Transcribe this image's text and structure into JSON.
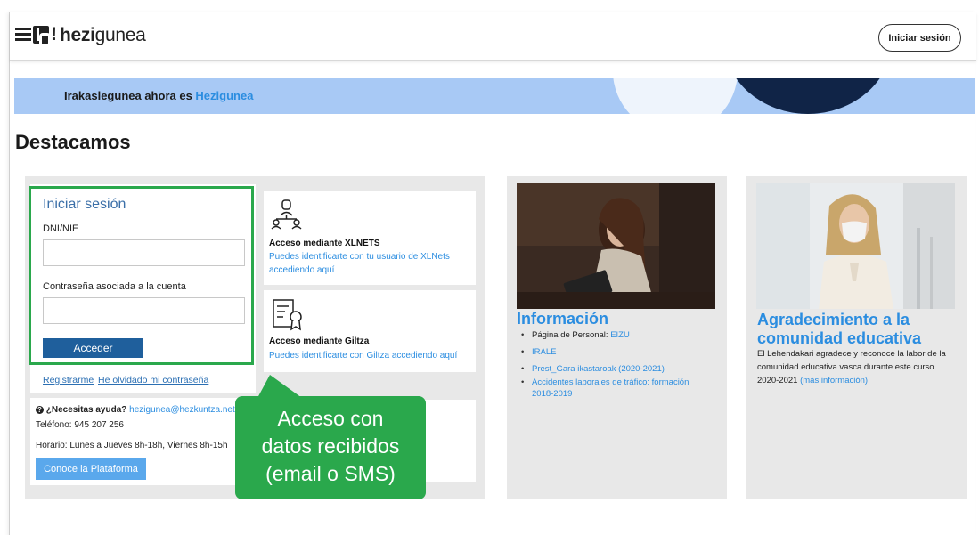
{
  "header": {
    "logo_excl": "!",
    "logo_bold": "hezi",
    "logo_rest": "gunea",
    "login_button": "Iniciar sesión"
  },
  "banner": {
    "text": "Irakaslegunea ahora es ",
    "link": "Hezigunea"
  },
  "section_title": "Destacamos",
  "login": {
    "title": "Iniciar sesión",
    "dni_label": "DNI/NIE",
    "dni_value": "",
    "password_label": "Contraseña asociada a la cuenta",
    "password_value": "",
    "submit": "Acceder",
    "register": "Registrarme",
    "forgot": "He olvidado mi contraseña"
  },
  "help": {
    "question": "¿Necesitas ayuda?",
    "email": "hezigunea@hezkuntza.net",
    "phone": "Teléfono: 945 207 256",
    "hours": "Horario: Lunes a Jueves 8h-18h, Viernes 8h-15h",
    "platform_button": "Conoce la Plataforma"
  },
  "access_options": [
    {
      "title": "Acceso mediante XLNETS",
      "desc_line1": "Puedes identificarte con tu usuario de XLNets",
      "desc_line2": "accediendo aquí",
      "icon": "user-network-icon"
    },
    {
      "title": "Acceso mediante Giltza",
      "desc_line1": "Puedes identificarte con Giltza accediendo aquí",
      "icon": "certificate-icon"
    }
  ],
  "callout": {
    "line1": "Acceso con",
    "line2": "datos recibidos",
    "line3": "(email o SMS)"
  },
  "informacion": {
    "title": "Información",
    "items": [
      {
        "text": "Página de Personal: ",
        "link": "EIZU"
      },
      {
        "text": "",
        "link": "IRALE"
      },
      {
        "text": "",
        "link": "Prest_Gara ikastaroak (2020-2021)"
      },
      {
        "text": "",
        "link": "Accidentes laborales de tráfico: formación",
        "link2": "2018-2019"
      }
    ]
  },
  "agradecimiento": {
    "title_line1": "Agradecimiento a la",
    "title_line2": "comunidad educativa",
    "p_line1": "El Lehendakari agradece y reconoce la labor de la",
    "p_line2": "comunidad educativa vasca durante este curso",
    "p_line3": "2020-2021 ",
    "p_link": "(más información)",
    "p_end": "."
  },
  "colors": {
    "accent_blue": "#2b8de0",
    "banner_blue": "#a8c9f5",
    "button_blue": "#1f5f9c",
    "highlight_green": "#2aa84c"
  }
}
